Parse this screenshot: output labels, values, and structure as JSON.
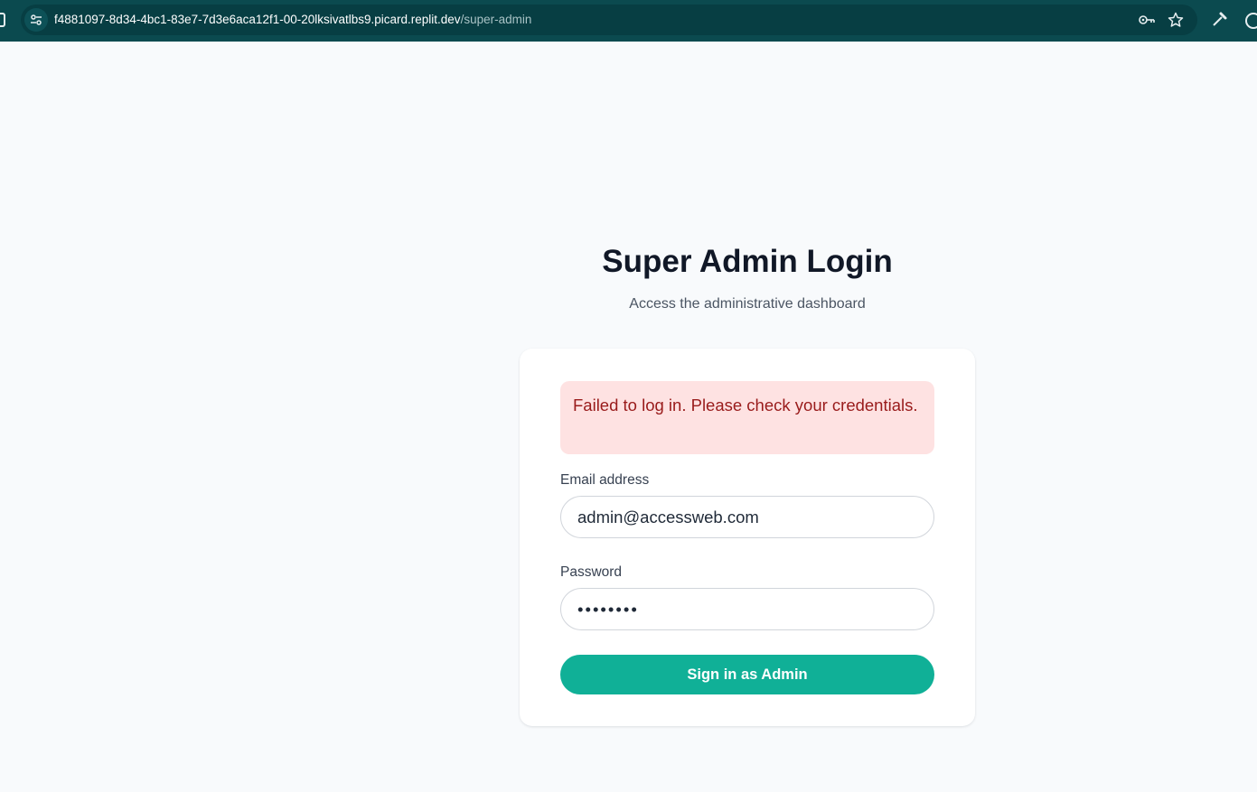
{
  "browser": {
    "url_host": "f4881097-8d34-4bc1-83e7-7d3e6aca12f1-00-20lksivatlbs9.picard.replit.dev",
    "url_path": "/super-admin",
    "icons": [
      "site-info-icon",
      "key-icon",
      "star-icon",
      "eyedropper-icon",
      "extension-icon"
    ]
  },
  "login": {
    "title": "Super Admin Login",
    "subtitle": "Access the administrative dashboard",
    "error_message": "Failed to log in. Please check your credentials.",
    "email_label": "Email address",
    "email_value": "admin@accessweb.com",
    "password_label": "Password",
    "password_value": "password",
    "submit_label": "Sign in as Admin"
  },
  "colors": {
    "browser_bar": "#0b4a4f",
    "accent": "#10b097",
    "error_background": "#fee2e2",
    "error_text": "#991b1b",
    "page_background": "#f8fafc"
  }
}
